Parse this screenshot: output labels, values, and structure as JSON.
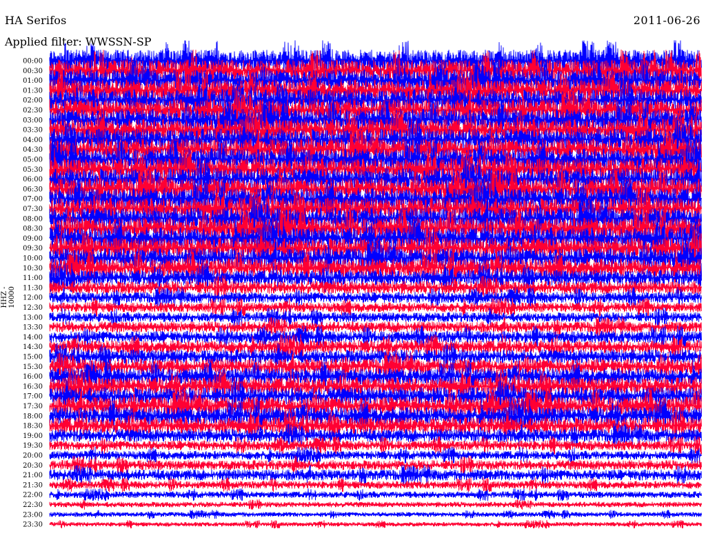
{
  "header": {
    "station": "HA Serifos",
    "date": "2011-06-26",
    "filter_label": "Applied filter: WWSSN-SP"
  },
  "channel_label": "HHZ - 10000",
  "colors": {
    "odd": "#0000ff",
    "even": "#ff0033",
    "background": "#ffffff"
  },
  "chart_data": {
    "type": "line",
    "subtype": "helicorder",
    "title": "HA Serifos",
    "subtitle": "Applied filter: WWSSN-SP",
    "date": "2011-06-26",
    "ylabel": "HHZ - 10000",
    "row_labels": [
      "00:00",
      "00:30",
      "01:00",
      "01:30",
      "02:00",
      "02:30",
      "03:00",
      "03:30",
      "04:00",
      "04:30",
      "05:00",
      "05:30",
      "06:00",
      "06:30",
      "07:00",
      "07:30",
      "08:00",
      "08:30",
      "09:00",
      "09:30",
      "10:00",
      "10:30",
      "11:00",
      "11:30",
      "12:00",
      "12:30",
      "13:00",
      "13:30",
      "14:00",
      "14:30",
      "15:00",
      "15:30",
      "16:00",
      "16:30",
      "17:00",
      "17:30",
      "18:00",
      "18:30",
      "19:00",
      "19:30",
      "20:00",
      "20:30",
      "21:00",
      "21:30",
      "22:00",
      "22:30",
      "23:00",
      "23:30"
    ],
    "row_amplitude_relative": [
      1.0,
      1.0,
      1.0,
      1.0,
      1.0,
      1.0,
      1.0,
      1.0,
      1.0,
      1.0,
      1.0,
      1.0,
      1.0,
      1.0,
      1.0,
      1.0,
      1.0,
      1.0,
      1.0,
      0.95,
      0.9,
      0.85,
      0.7,
      0.6,
      0.5,
      0.45,
      0.45,
      0.5,
      0.55,
      0.6,
      0.65,
      0.7,
      0.75,
      0.8,
      0.8,
      0.85,
      0.8,
      0.75,
      0.6,
      0.45,
      0.4,
      0.45,
      0.5,
      0.35,
      0.3,
      0.25,
      0.22,
      0.2
    ],
    "series_colors_alternate": [
      "blue",
      "red"
    ],
    "grid": false
  }
}
